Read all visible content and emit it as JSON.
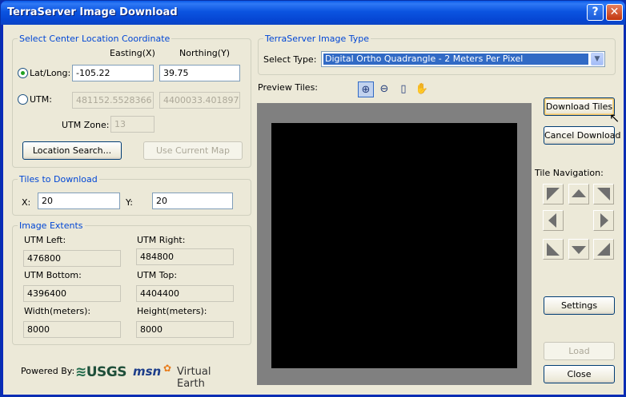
{
  "window": {
    "title": "TerraServer Image Download",
    "help_label": "?",
    "close_label": "✕"
  },
  "center": {
    "group_title": "Select Center Location Coordinate",
    "easting_header": "Easting(X)",
    "northing_header": "Northing(Y)",
    "latlong_label": "Lat/Long:",
    "latlong_x": "-105.22",
    "latlong_y": "39.75",
    "utm_label": "UTM:",
    "utm_x": "481152.5528366",
    "utm_y": "4400033.401897",
    "utm_zone_label": "UTM Zone:",
    "utm_zone": "13",
    "location_search_label": "Location Search...",
    "use_current_map_label": "Use Current Map"
  },
  "tiles": {
    "group_title": "Tiles to Download",
    "x_label": "X:",
    "x_value": "20",
    "y_label": "Y:",
    "y_value": "20"
  },
  "extents": {
    "group_title": "Image Extents",
    "utm_left_label": "UTM Left:",
    "utm_left": "476800",
    "utm_right_label": "UTM Right:",
    "utm_right": "484800",
    "utm_bottom_label": "UTM Bottom:",
    "utm_bottom": "4396400",
    "utm_top_label": "UTM Top:",
    "utm_top": "4404400",
    "width_label": "Width(meters):",
    "width": "8000",
    "height_label": "Height(meters):",
    "height": "8000"
  },
  "powered": {
    "label": "Powered By:",
    "usgs": "USGS",
    "msn": "msn",
    "ve": "Virtual Earth"
  },
  "image_type": {
    "group_title": "TerraServer Image Type",
    "select_label": "Select Type:",
    "selected": "Digital Ortho Quadrangle - 2 Meters Per Pixel"
  },
  "preview": {
    "label": "Preview Tiles:"
  },
  "buttons": {
    "download": "Download Tiles",
    "cancel": "Cancel Download",
    "tile_nav_label": "Tile Navigation:",
    "settings": "Settings",
    "load": "Load",
    "close": "Close"
  },
  "icons": [
    "zoom-in-icon",
    "zoom-out-icon",
    "full-extent-icon",
    "pan-hand-icon"
  ]
}
